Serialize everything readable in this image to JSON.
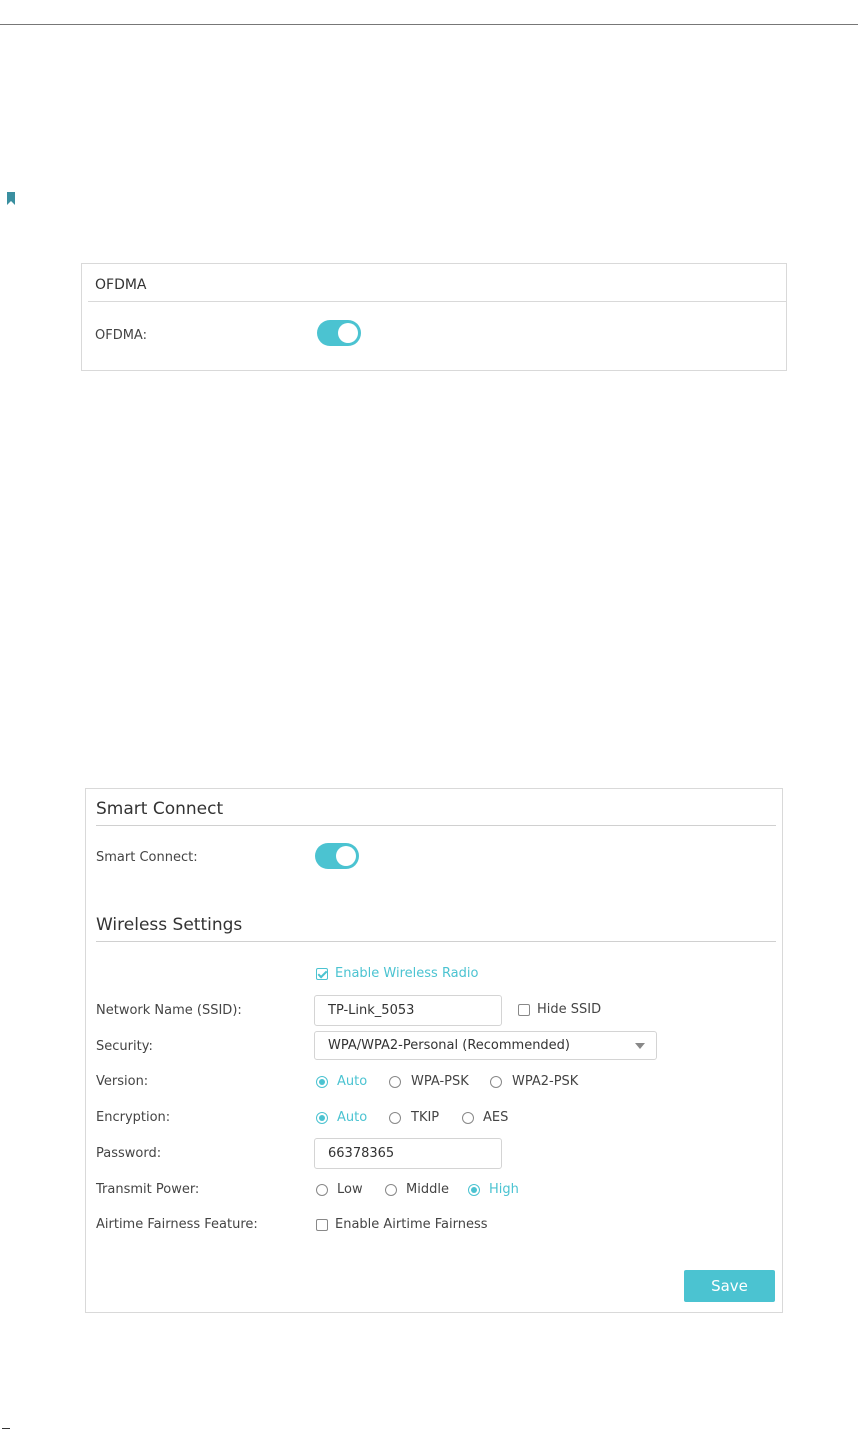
{
  "ofdma": {
    "title": "OFDMA",
    "label": "OFDMA:",
    "enabled": true
  },
  "smart_connect": {
    "title": "Smart Connect",
    "label": "Smart Connect:",
    "enabled": true
  },
  "wireless": {
    "title": "Wireless Settings",
    "enable_radio_label": "Enable Wireless Radio",
    "enable_radio_checked": true,
    "ssid_label": "Network Name (SSID):",
    "ssid_value": "TP-Link_5053",
    "hide_ssid_label": "Hide SSID",
    "hide_ssid_checked": false,
    "security_label": "Security:",
    "security_value": "WPA/WPA2-Personal (Recommended)",
    "version_label": "Version:",
    "version_options": [
      "Auto",
      "WPA-PSK",
      "WPA2-PSK"
    ],
    "version_selected": "Auto",
    "encryption_label": "Encryption:",
    "encryption_options": [
      "Auto",
      "TKIP",
      "AES"
    ],
    "encryption_selected": "Auto",
    "password_label": "Password:",
    "password_value": "66378365",
    "power_label": "Transmit Power:",
    "power_options": [
      "Low",
      "Middle",
      "High"
    ],
    "power_selected": "High",
    "airtime_label": "Airtime Fairness Feature:",
    "airtime_option_label": "Enable Airtime Fairness",
    "airtime_checked": false,
    "save_label": "Save"
  },
  "colors": {
    "accent": "#4bc3d1",
    "border": "#d9d9d9",
    "text": "#444444"
  }
}
